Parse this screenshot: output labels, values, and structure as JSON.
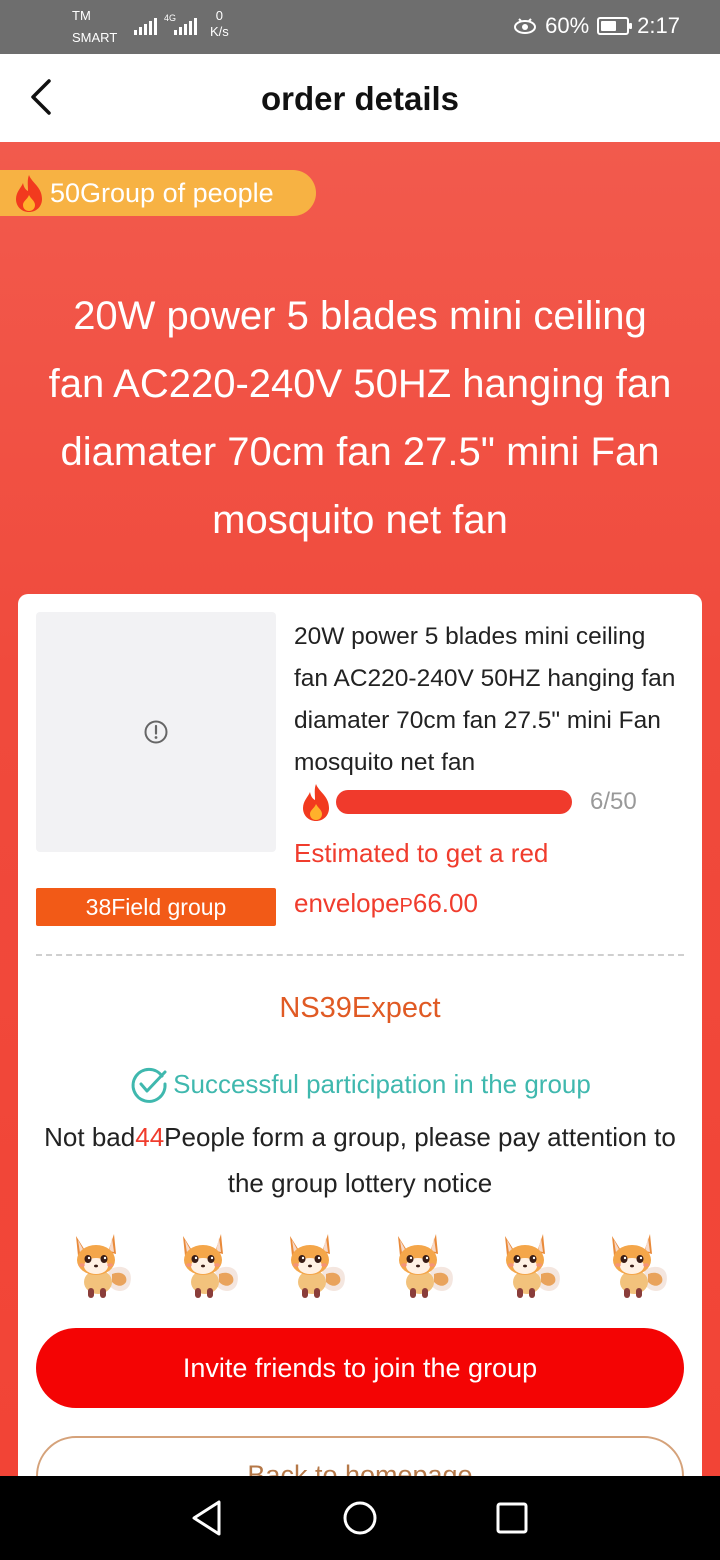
{
  "status_bar": {
    "carrier_line1": "TM",
    "carrier_line2": "SMART",
    "network_type": "4G",
    "netspeed_value": "0",
    "netspeed_unit": "K/s",
    "battery_percent": "60%",
    "battery_level": 0.6,
    "time": "2:17"
  },
  "header": {
    "title": "order details"
  },
  "hero": {
    "group_badge": "50Group of people",
    "product_title": "20W power 5 blades mini ceiling fan AC220-240V 50HZ hanging fan diamater 70cm fan 27.5\" mini Fan mosquito net fan"
  },
  "card": {
    "product_name": "20W power 5 blades mini ceiling fan AC220-240V 50HZ hanging fan diamater 70cm fan 27.5\" mini Fan mosquito net fan",
    "field_group": "38Field group",
    "progress": {
      "joined": 6,
      "total": 50,
      "label": "6/50"
    },
    "estimate_text": "Estimated to get a red envelope",
    "estimate_currency": "P",
    "estimate_amount": "66.00",
    "expect_text": "NS39Expect",
    "success_text": "Successful participation in the group",
    "notice_prefix": "Not bad",
    "notice_number": "44",
    "notice_suffix": "People form a group, please pay attention to the group lottery notice",
    "invite_button": "Invite friends to join the group",
    "home_button": "Back to homepage"
  },
  "colors": {
    "primary_red": "#f40404",
    "hero_red": "#f04a3c",
    "badge_orange": "#f7b243",
    "success_teal": "#3fb8ae"
  },
  "icons": {
    "back": "chevron-left-icon",
    "image_error": "info-circle-icon",
    "fire": "fire-icon",
    "check": "check-circle-icon"
  }
}
